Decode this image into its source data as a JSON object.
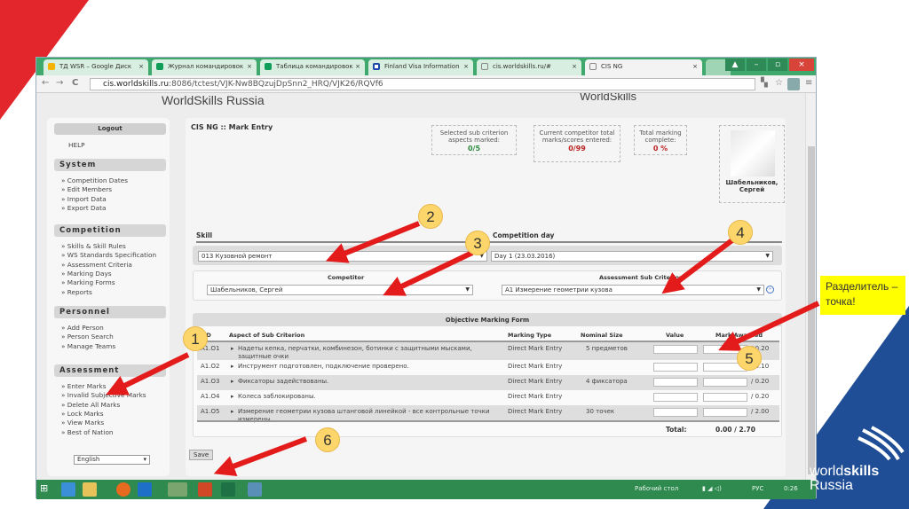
{
  "browser": {
    "tabs": [
      {
        "label": "ТД WSR – Google Диск",
        "icon": "google-drive-icon"
      },
      {
        "label": "Журнал командировок",
        "icon": "sheets-icon"
      },
      {
        "label": "Таблица командировок",
        "icon": "sheets-icon"
      },
      {
        "label": "Finland Visa Information",
        "icon": "finland-flag-icon"
      },
      {
        "label": "cis.worldskills.ru/#",
        "icon": "page-icon"
      },
      {
        "label": "CIS NG",
        "icon": "page-icon",
        "active": true
      }
    ],
    "url_host": "cis.worldskills.ru",
    "url_rest": ":8086/tctest/VJK-Nw8BQzujDpSnn2_HRQ/VJK26/RQVf6"
  },
  "header": {
    "logo_left": "WorldSkills Russia",
    "logo_right": "WorldSkills"
  },
  "sidebar": {
    "logout": "Logout",
    "help": "HELP",
    "sections": [
      {
        "title": "System",
        "items": [
          "Competition Dates",
          "Edit Members",
          "Import Data",
          "Export Data"
        ]
      },
      {
        "title": "Competition",
        "items": [
          "Skills & Skill Rules",
          "WS Standards Specification",
          "Assessment Criteria",
          "Marking Days",
          "Marking Forms",
          "Reports"
        ]
      },
      {
        "title": "Personnel",
        "items": [
          "Add Person",
          "Person Search",
          "Manage Teams"
        ]
      },
      {
        "title": "Assessment",
        "items": [
          "Enter Marks",
          "Invalid Subjective Marks",
          "Delete All Marks",
          "Lock Marks",
          "View Marks",
          "Best of Nation"
        ]
      }
    ],
    "language": "English"
  },
  "main": {
    "title": "CIS NG :: Mark Entry",
    "stats": [
      {
        "label": "Selected sub criterion aspects marked:",
        "value": "0/5"
      },
      {
        "label": "Current competitor total marks/scores entered:",
        "value": "0/99"
      },
      {
        "label": "Total marking complete:",
        "value": "0 %"
      }
    ],
    "competitor_name": "Шабельников, Сергей",
    "skill_label": "Skill",
    "skill_value": "013 Кузовной ремонт",
    "day_label": "Competition day",
    "day_value": "Day 1 (23.03.2016)",
    "competitor_label": "Competitor",
    "competitor_value": "Шабельников, Сергей",
    "subcrit_label": "Assessment Sub Criterion",
    "subcrit_value": "A1 Измерение геометрии кузова",
    "form_title": "Objective Marking Form",
    "columns": [
      "ID",
      "Aspect of Sub Criterion",
      "Marking Type",
      "Nominal Size",
      "Value",
      "Mark Awarded"
    ],
    "rows": [
      {
        "id": "A1.O1",
        "aspect": "Надеты кепка, перчатки, комбинезон, ботинки с защитными мысками, защитные очки",
        "type": "Direct Mark Entry",
        "nominal": "5 предметов",
        "max": "/ 0.20"
      },
      {
        "id": "A1.O2",
        "aspect": "Инструмент подготовлен, подключение проверено.",
        "type": "Direct Mark Entry",
        "nominal": "",
        "max": "/ 0.10"
      },
      {
        "id": "A1.O3",
        "aspect": "Фиксаторы задействованы.",
        "type": "Direct Mark Entry",
        "nominal": "4 фиксатора",
        "max": "/ 0.20"
      },
      {
        "id": "A1.O4",
        "aspect": "Колеса заблокированы.",
        "type": "Direct Mark Entry",
        "nominal": "",
        "max": "/ 0.20"
      },
      {
        "id": "A1.O5",
        "aspect": "Измерение геометрии кузова штанговой линейкой - все контрольные точки измерены.",
        "type": "Direct Mark Entry",
        "nominal": "30 точек",
        "max": "/ 2.00"
      }
    ],
    "total_label": "Total:",
    "total_value": "0.00 / 2.70",
    "save": "Save"
  },
  "taskbar": {
    "desktop": "Рабочий стол",
    "lang": "РУС",
    "time": "0:26"
  },
  "annotations": {
    "badges": [
      "1",
      "2",
      "3",
      "4",
      "5",
      "6"
    ],
    "callout": "Разделитель – точка!"
  },
  "slide_logo": "worldskills Russia",
  "colors": {
    "accent_red": "#e3262b",
    "brand_blue": "#1f4e96",
    "taskbar": "#2f8a4f",
    "callout": "#ffff00"
  }
}
